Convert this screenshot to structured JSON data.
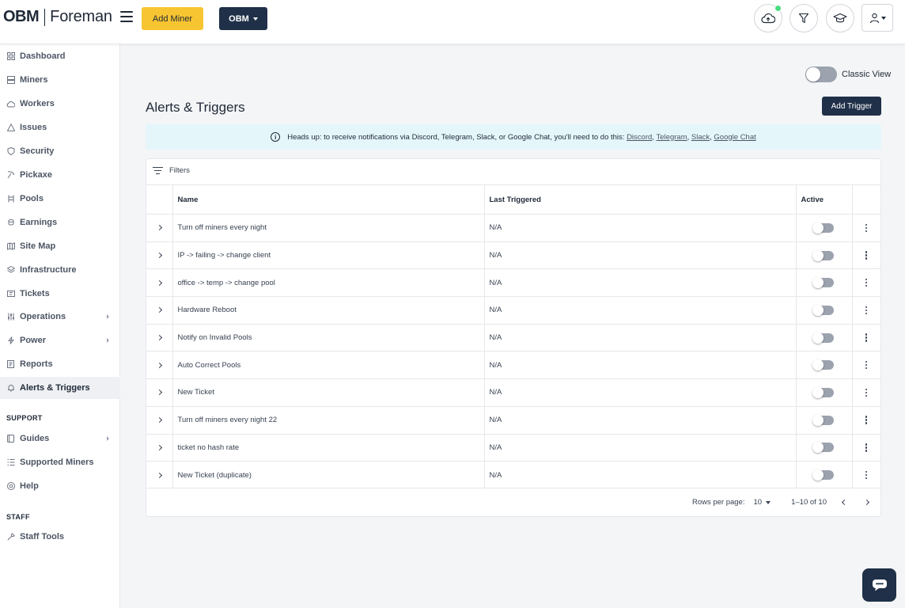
{
  "header": {
    "logo_obm": "OBM",
    "logo_foreman": "Foreman",
    "add_miner_label": "Add Miner",
    "org_label": "OBM",
    "icons": [
      "cloud-upload-icon",
      "filter-icon",
      "graduation-cap-icon",
      "user-icon"
    ],
    "status_color": "#4ade80"
  },
  "sidebar": {
    "items": [
      {
        "label": "Dashboard",
        "icon": "grid-icon"
      },
      {
        "label": "Miners",
        "icon": "server-icon"
      },
      {
        "label": "Workers",
        "icon": "cloud-icon"
      },
      {
        "label": "Issues",
        "icon": "warning-icon"
      },
      {
        "label": "Security",
        "icon": "shield-icon"
      },
      {
        "label": "Pickaxe",
        "icon": "pickaxe-icon"
      },
      {
        "label": "Pools",
        "icon": "pools-icon"
      },
      {
        "label": "Earnings",
        "icon": "coins-icon"
      },
      {
        "label": "Site Map",
        "icon": "map-icon"
      },
      {
        "label": "Infrastructure",
        "icon": "layers-icon"
      },
      {
        "label": "Tickets",
        "icon": "ticket-icon"
      },
      {
        "label": "Operations",
        "icon": "sliders-icon"
      },
      {
        "label": "Power",
        "icon": "bolt-icon"
      },
      {
        "label": "Reports",
        "icon": "report-icon"
      },
      {
        "label": "Alerts & Triggers",
        "icon": "bell-icon"
      }
    ],
    "support_label": "SUPPORT",
    "support_items": [
      {
        "label": "Guides",
        "icon": "book-icon"
      },
      {
        "label": "Supported Miners",
        "icon": "list-icon"
      },
      {
        "label": "Help",
        "icon": "help-icon"
      }
    ],
    "staff_label": "STAFF",
    "staff_items": [
      {
        "label": "Staff Tools",
        "icon": "wrench-icon"
      }
    ]
  },
  "main": {
    "classic_view_label": "Classic View",
    "title": "Alerts & Triggers",
    "add_trigger_label": "Add Trigger",
    "alert_text": "Heads up: to receive notifications via Discord, Telegram, Slack, or Google Chat, you'll need to do this:",
    "alert_links": [
      "Discord",
      "Telegram",
      "Slack",
      "Google Chat"
    ],
    "filters_label": "Filters",
    "columns": {
      "name": "Name",
      "last_triggered": "Last Triggered",
      "active": "Active"
    },
    "rows": [
      {
        "name": "Turn off miners every night",
        "last": "N/A"
      },
      {
        "name": "IP -> failing -> change client",
        "last": "N/A"
      },
      {
        "name": "office -> temp -> change pool",
        "last": "N/A"
      },
      {
        "name": "Hardware Reboot",
        "last": "N/A"
      },
      {
        "name": "Notify on Invalid Pools",
        "last": "N/A"
      },
      {
        "name": "Auto Correct Pools",
        "last": "N/A"
      },
      {
        "name": "New Ticket",
        "last": "N/A"
      },
      {
        "name": "Turn off miners every night 22",
        "last": "N/A"
      },
      {
        "name": "ticket no hash rate",
        "last": "N/A"
      },
      {
        "name": "New Ticket (duplicate)",
        "last": "N/A"
      }
    ],
    "rows_per_page_label": "Rows per page:",
    "rows_per_page_value": "10",
    "range_label": "1–10 of 10"
  },
  "colors": {
    "accent_yellow": "#f7c531",
    "navy": "#1f3048",
    "alert_bg": "#e5f6fb"
  }
}
